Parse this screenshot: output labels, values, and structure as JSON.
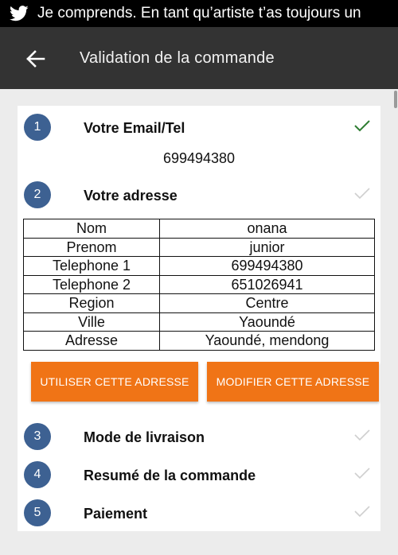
{
  "status_bar": {
    "icon": "twitter-icon",
    "notification": "Je comprends. En tant qu’artiste t’as toujours un"
  },
  "app_bar": {
    "back_icon": "arrow-left-icon",
    "title": "Validation de la commande"
  },
  "colors": {
    "app_bar": "#333333",
    "step_circle": "#3d6192",
    "button": "#f07416",
    "check_done": "#2e7d32",
    "check_pending": "#cfcfcf"
  },
  "steps": [
    {
      "number": "1",
      "label": "Votre Email/Tel",
      "status": "done"
    },
    {
      "number": "2",
      "label": "Votre adresse",
      "status": "pending"
    },
    {
      "number": "3",
      "label": "Mode de livraison",
      "status": "pending"
    },
    {
      "number": "4",
      "label": "Resumé de la commande",
      "status": "pending"
    },
    {
      "number": "5",
      "label": "Paiement",
      "status": "pending"
    }
  ],
  "email": {
    "value": "699494380"
  },
  "address": {
    "rows": [
      {
        "key": "Nom",
        "value": "onana"
      },
      {
        "key": "Prenom",
        "value": "junior"
      },
      {
        "key": "Telephone 1",
        "value": "699494380"
      },
      {
        "key": "Telephone 2",
        "value": "651026941"
      },
      {
        "key": "Region",
        "value": "Centre"
      },
      {
        "key": "Ville",
        "value": "Yaoundé"
      },
      {
        "key": "Adresse",
        "value": "Yaoundé, mendong"
      }
    ],
    "use_button": "UTILISER CETTE ADRESSE",
    "edit_button": "MODIFIER CETTE ADRESSE"
  }
}
